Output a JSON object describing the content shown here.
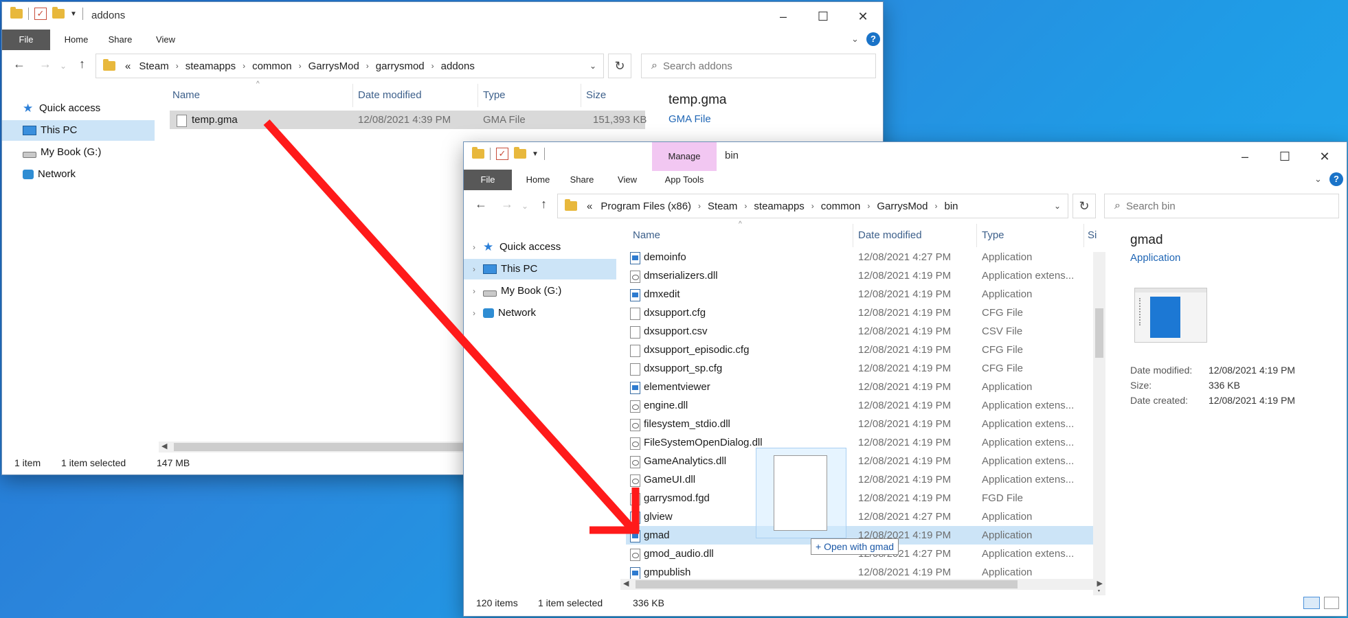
{
  "win1": {
    "title": "addons",
    "ribbon_tabs": [
      "File",
      "Home",
      "Share",
      "View"
    ],
    "path": [
      "Steam",
      "steamapps",
      "common",
      "GarrysMod",
      "garrysmod",
      "addons"
    ],
    "path_prefix": "«",
    "search_placeholder": "Search addons",
    "nav": [
      "Quick access",
      "This PC",
      "My Book (G:)",
      "Network"
    ],
    "columns": [
      "Name",
      "Date modified",
      "Type",
      "Size"
    ],
    "files": [
      {
        "name": "temp.gma",
        "date": "12/08/2021 4:39 PM",
        "type": "GMA File",
        "size": "151,393 KB"
      }
    ],
    "preview": {
      "title": "temp.gma",
      "type": "GMA File"
    },
    "status": {
      "count": "1 item",
      "selected": "1 item selected",
      "size": "147 MB"
    }
  },
  "win2": {
    "title": "bin",
    "manage_label": "Manage",
    "app_tools_label": "App Tools",
    "ribbon_tabs": [
      "File",
      "Home",
      "Share",
      "View"
    ],
    "path": [
      "Program Files (x86)",
      "Steam",
      "steamapps",
      "common",
      "GarrysMod",
      "bin"
    ],
    "path_prefix": "«",
    "search_placeholder": "Search bin",
    "nav": [
      "Quick access",
      "This PC",
      "My Book (G:)",
      "Network"
    ],
    "columns": [
      "Name",
      "Date modified",
      "Type",
      "Si"
    ],
    "files": [
      {
        "name": "demoinfo",
        "date": "12/08/2021 4:27 PM",
        "type": "Application",
        "icon": "app"
      },
      {
        "name": "dmserializers.dll",
        "date": "12/08/2021 4:19 PM",
        "type": "Application extens...",
        "icon": "dll"
      },
      {
        "name": "dmxedit",
        "date": "12/08/2021 4:19 PM",
        "type": "Application",
        "icon": "app"
      },
      {
        "name": "dxsupport.cfg",
        "date": "12/08/2021 4:19 PM",
        "type": "CFG File",
        "icon": "file"
      },
      {
        "name": "dxsupport.csv",
        "date": "12/08/2021 4:19 PM",
        "type": "CSV File",
        "icon": "file"
      },
      {
        "name": "dxsupport_episodic.cfg",
        "date": "12/08/2021 4:19 PM",
        "type": "CFG File",
        "icon": "file"
      },
      {
        "name": "dxsupport_sp.cfg",
        "date": "12/08/2021 4:19 PM",
        "type": "CFG File",
        "icon": "file"
      },
      {
        "name": "elementviewer",
        "date": "12/08/2021 4:19 PM",
        "type": "Application",
        "icon": "app"
      },
      {
        "name": "engine.dll",
        "date": "12/08/2021 4:19 PM",
        "type": "Application extens...",
        "icon": "dll"
      },
      {
        "name": "filesystem_stdio.dll",
        "date": "12/08/2021 4:19 PM",
        "type": "Application extens...",
        "icon": "dll"
      },
      {
        "name": "FileSystemOpenDialog.dll",
        "date": "12/08/2021 4:19 PM",
        "type": "Application extens...",
        "icon": "dll"
      },
      {
        "name": "GameAnalytics.dll",
        "date": "12/08/2021 4:19 PM",
        "type": "Application extens...",
        "icon": "dll"
      },
      {
        "name": "GameUI.dll",
        "date": "12/08/2021 4:19 PM",
        "type": "Application extens...",
        "icon": "dll"
      },
      {
        "name": "garrysmod.fgd",
        "date": "12/08/2021 4:19 PM",
        "type": "FGD File",
        "icon": "file"
      },
      {
        "name": "glview",
        "date": "12/08/2021 4:27 PM",
        "type": "Application",
        "icon": "app"
      },
      {
        "name": "gmad",
        "date": "12/08/2021 4:19 PM",
        "type": "Application",
        "icon": "app",
        "selected": true
      },
      {
        "name": "gmod_audio.dll",
        "date": "12/08/2021 4:27 PM",
        "type": "Application extens...",
        "icon": "dll"
      },
      {
        "name": "gmpublish",
        "date": "12/08/2021 4:19 PM",
        "type": "Application",
        "icon": "app"
      }
    ],
    "preview": {
      "title": "gmad",
      "type": "Application",
      "date_modified_label": "Date modified:",
      "date_modified": "12/08/2021 4:19 PM",
      "size_label": "Size:",
      "size": "336 KB",
      "date_created_label": "Date created:",
      "date_created": "12/08/2021 4:19 PM"
    },
    "status": {
      "count": "120 items",
      "selected": "1 item selected",
      "size": "336 KB"
    }
  },
  "drag": {
    "tooltip": "+ Open with gmad"
  },
  "colors": {
    "arrow": "#ff1a1a",
    "selection": "#cce4f7",
    "accent": "#1f66b5"
  }
}
